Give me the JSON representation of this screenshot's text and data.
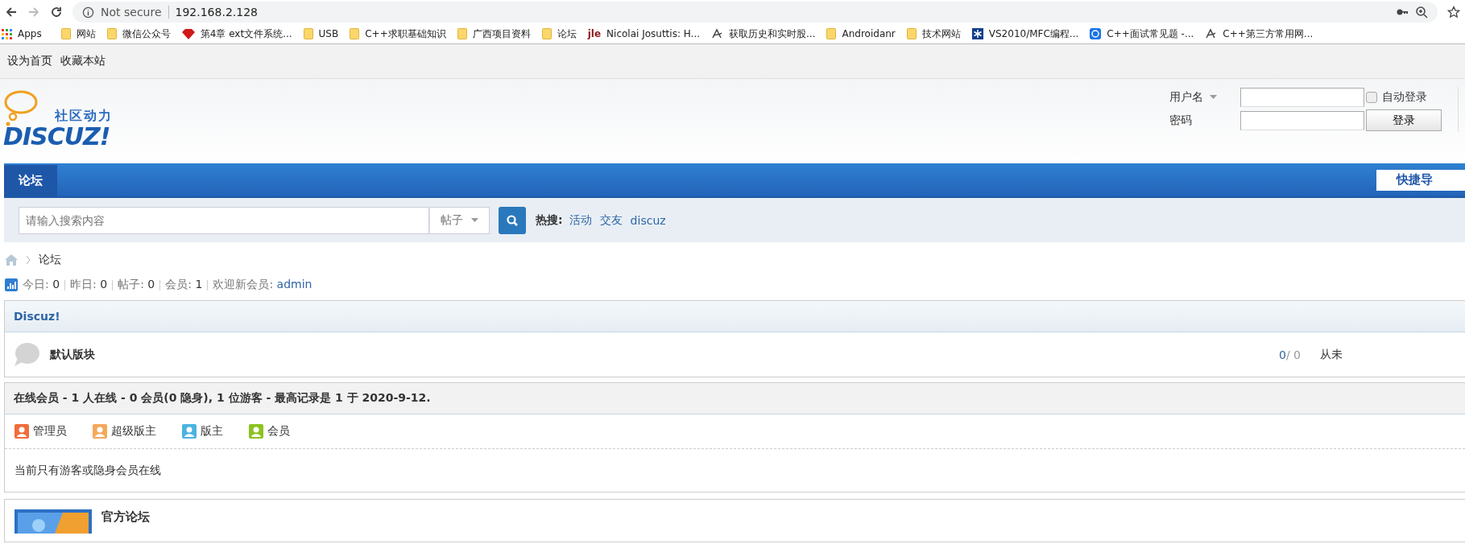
{
  "browser": {
    "security": "Not secure",
    "url": "192.168.2.128",
    "bookmarks": [
      {
        "kind": "apps",
        "label": "Apps"
      },
      {
        "kind": "folder",
        "label": "网站"
      },
      {
        "kind": "folder",
        "label": "微信公众号"
      },
      {
        "kind": "gem",
        "label": "第4章 ext文件系统..."
      },
      {
        "kind": "folder",
        "label": "USB"
      },
      {
        "kind": "folder",
        "label": "C++求职基础知识"
      },
      {
        "kind": "folder",
        "label": "广西项目资料"
      },
      {
        "kind": "folder",
        "label": "论坛"
      },
      {
        "kind": "text",
        "mark": "jle",
        "label": "Nicolai Josuttis: H..."
      },
      {
        "kind": "swirl",
        "label": "获取历史和实时股..."
      },
      {
        "kind": "folder",
        "label": "Androidanr"
      },
      {
        "kind": "folder",
        "label": "技术网站"
      },
      {
        "kind": "star",
        "label": "VS2010/MFC编程..."
      },
      {
        "kind": "ring",
        "label": "C++面试常见题 -..."
      },
      {
        "kind": "swirl",
        "label": "C++第三方常用网..."
      }
    ]
  },
  "topbar": {
    "links": [
      "设为首页",
      "收藏本站"
    ]
  },
  "header": {
    "logo_tagline": "社区动力",
    "logo_name": "DISCUZ!",
    "login": {
      "username_label": "用户名",
      "password_label": "密码",
      "remember_label": "自动登录",
      "remember_checked": false,
      "submit": "登录"
    }
  },
  "nav": {
    "items": [
      {
        "label": "论坛",
        "selected": true
      }
    ],
    "quick_nav": "快捷导"
  },
  "search": {
    "placeholder": "请输入搜索内容",
    "type": "帖子",
    "hot_label": "热搜:",
    "hot": [
      "活动",
      "交友",
      "discuz"
    ]
  },
  "breadcrumb": [
    "论坛"
  ],
  "stats": [
    {
      "label": "今日:",
      "value": "0"
    },
    {
      "label": "昨日:",
      "value": "0"
    },
    {
      "label": "帖子:",
      "value": "0"
    },
    {
      "label": "会员:",
      "value": "1"
    },
    {
      "label": "欢迎新会员:",
      "value": "admin"
    }
  ],
  "category": {
    "title": "Discuz!",
    "forums": [
      {
        "name": "默认版块",
        "threads": "0",
        "separator": "/",
        "posts": "0",
        "last_post": "从未"
      }
    ]
  },
  "online": {
    "title": "在线会员 - 1 人在线 - 0 会员(0 隐身), 1 位游客 - 最高记录是 1 于 2020-9-12.",
    "legend": [
      {
        "label": "管理员",
        "color": "#f26c3a"
      },
      {
        "label": "超级版主",
        "color": "#f5a85a"
      },
      {
        "label": "版主",
        "color": "#4cb3e0"
      },
      {
        "label": "会员",
        "color": "#8dc21f"
      }
    ],
    "note": "当前只有游客或隐身会员在线"
  },
  "partner": {
    "title": "官方论坛"
  }
}
